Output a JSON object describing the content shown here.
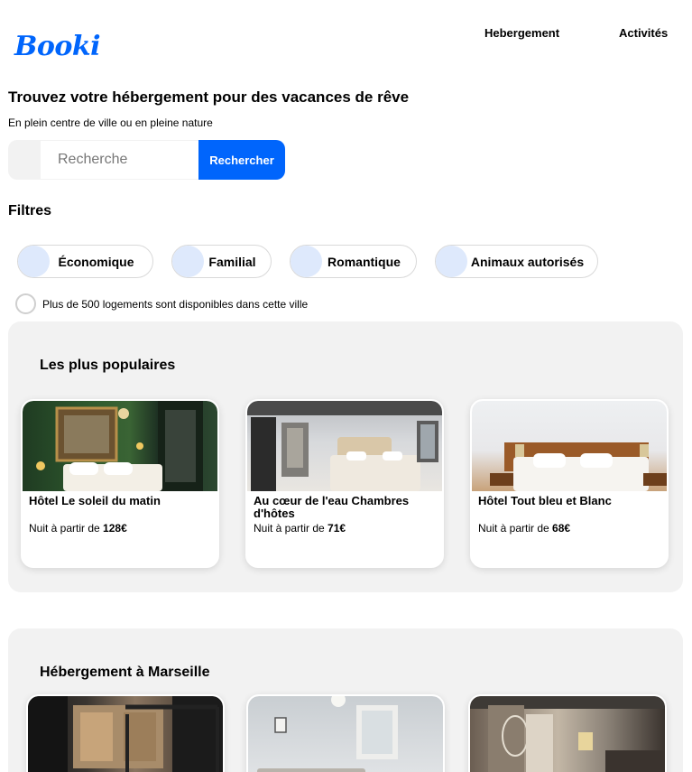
{
  "brand": {
    "name": "Booki",
    "color": "#0065fc"
  },
  "nav": {
    "items": [
      {
        "label": "Hebergement"
      },
      {
        "label": "Activités"
      }
    ]
  },
  "hero": {
    "title": "Trouvez votre hébergement pour des vacances de rêve",
    "subtitle": "En plein centre de ville ou en pleine nature"
  },
  "search": {
    "placeholder": "Recherche",
    "value": "",
    "button_label": "Rechercher"
  },
  "filters": {
    "title": "Filtres",
    "chips": [
      {
        "label": "Économique"
      },
      {
        "label": "Familial"
      },
      {
        "label": "Romantique"
      },
      {
        "label": "Animaux autorisés"
      }
    ]
  },
  "info": {
    "text": "Plus de 500 logements sont disponibles dans cette ville"
  },
  "popular": {
    "title": "Les plus populaires",
    "cards": [
      {
        "name": "Hôtel Le soleil du matin",
        "price_prefix": "Nuit à partir de ",
        "price": "128€"
      },
      {
        "name": "Au cœur de l'eau Chambres d'hôtes",
        "price_prefix": "Nuit à partir de ",
        "price": "71€"
      },
      {
        "name": "Hôtel Tout bleu et Blanc",
        "price_prefix": "Nuit à partir de ",
        "price": "68€"
      }
    ]
  },
  "marseille": {
    "title": "Hébergement à Marseille"
  }
}
